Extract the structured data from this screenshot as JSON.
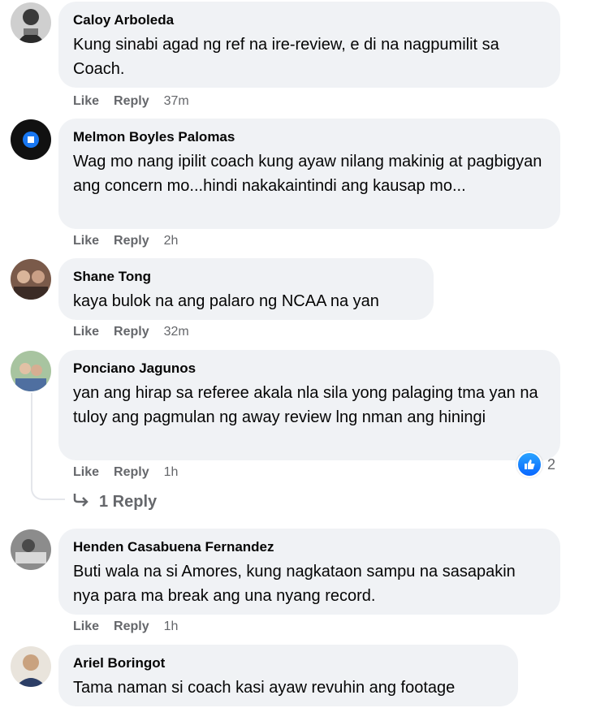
{
  "comments": [
    {
      "author": "Caloy Arboleda",
      "text": "Kung sinabi agad ng ref na ire-review, e di na nagpumilit sa Coach.",
      "like": "Like",
      "reply": "Reply",
      "time": "37m"
    },
    {
      "author": "Melmon Boyles Palomas",
      "text": "Wag mo nang ipilit coach kung ayaw nilang makinig at pagbigyan ang concern mo...hindi nakakaintindi ang kausap mo...",
      "like": "Like",
      "reply": "Reply",
      "time": "2h"
    },
    {
      "author": "Shane Tong",
      "text": "kaya bulok na ang palaro ng NCAA na yan",
      "like": "Like",
      "reply": "Reply",
      "time": "32m"
    },
    {
      "author": "Ponciano Jagunos",
      "text": "yan ang hirap sa referee akala nla sila yong palaging tma yan na tuloy ang pagmulan ng away review lng nman ang hiningi",
      "like": "Like",
      "reply": "Reply",
      "time": "1h",
      "reaction_count": "2",
      "replies_label": "1 Reply"
    },
    {
      "author": "Henden Casabuena Fernandez",
      "text": "Buti wala na si Amores, kung nagkataon sampu na sasapakin nya para ma break ang una nyang record.",
      "like": "Like",
      "reply": "Reply",
      "time": "1h"
    },
    {
      "author": "Ariel Boringot",
      "text": "Tama naman si coach kasi ayaw revuhin ang footage"
    }
  ],
  "colors": {
    "bubble": "#f0f2f5",
    "meta": "#65676b",
    "like_blue": "#0866ff"
  }
}
